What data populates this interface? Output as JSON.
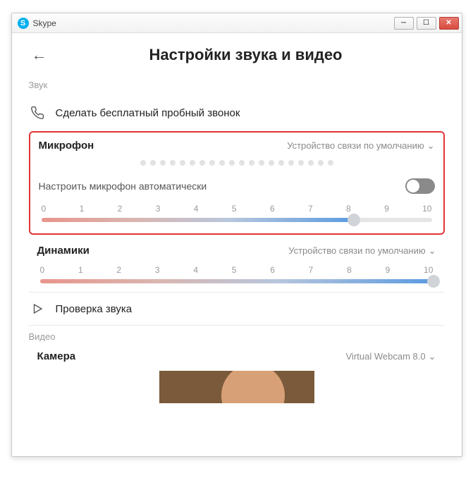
{
  "window": {
    "title": "Skype"
  },
  "header": {
    "title": "Настройки звука и видео"
  },
  "sections": {
    "sound": "Звук",
    "video": "Видео"
  },
  "testCall": {
    "label": "Сделать бесплатный пробный звонок"
  },
  "microphone": {
    "label": "Микрофон",
    "device": "Устройство связи по умолчанию",
    "autoLabel": "Настроить микрофон автоматически",
    "autoEnabled": false,
    "scale": [
      "0",
      "1",
      "2",
      "3",
      "4",
      "5",
      "6",
      "7",
      "8",
      "9",
      "10"
    ],
    "value": 8,
    "max": 10
  },
  "speakers": {
    "label": "Динамики",
    "device": "Устройство связи по умолчанию",
    "scale": [
      "0",
      "1",
      "2",
      "3",
      "4",
      "5",
      "6",
      "7",
      "8",
      "9",
      "10"
    ],
    "value": 10,
    "max": 10
  },
  "soundTest": {
    "label": "Проверка звука"
  },
  "camera": {
    "label": "Камера",
    "device": "Virtual Webcam 8.0"
  }
}
